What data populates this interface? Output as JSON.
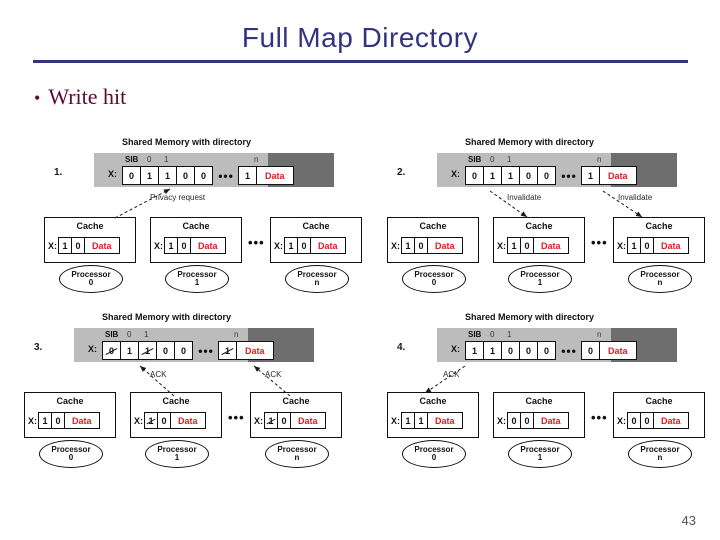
{
  "slide": {
    "title": "Full Map Directory",
    "bullet_marker": "•",
    "bullet_text": "Write hit",
    "page_number": "43",
    "colors": {
      "title": "#333380",
      "bullet": "#5b0a32",
      "data_text": "#e01b24",
      "memory_bar": "#bcbcbc",
      "memory_bar_dark": "#6e6e6e"
    }
  },
  "common": {
    "memory_title": "Shared Memory with directory",
    "sib_label": "SIB",
    "x_label": "X:",
    "cache_label": "Cache",
    "data_label": "Data",
    "ellipsis": "•••",
    "index_first": "0",
    "index_second": "1",
    "index_last": "n",
    "processor_word": "Processor"
  },
  "panels": [
    {
      "number": "1.",
      "memory_bits": [
        "0",
        "1",
        "1",
        "0",
        "0"
      ],
      "memory_bits_struck": [
        false,
        false,
        false,
        false,
        false
      ],
      "memory_last_bit": "1",
      "memory_last_struck": false,
      "memory_data": "Data",
      "arrow_labels": [
        "Privacy request"
      ],
      "caches": [
        {
          "bits": [
            "1",
            "0"
          ],
          "struck": [
            false,
            false
          ],
          "data": "Data"
        },
        {
          "bits": [
            "1",
            "0"
          ],
          "struck": [
            false,
            false
          ],
          "data": "Data"
        },
        {
          "bits": [
            "1",
            "0"
          ],
          "struck": [
            false,
            false
          ],
          "data": "Data"
        }
      ],
      "processors": [
        "0",
        "1",
        "n"
      ]
    },
    {
      "number": "2.",
      "memory_bits": [
        "0",
        "1",
        "1",
        "0",
        "0"
      ],
      "memory_bits_struck": [
        false,
        false,
        false,
        false,
        false
      ],
      "memory_last_bit": "1",
      "memory_last_struck": false,
      "memory_data": "Data",
      "arrow_labels": [
        "Invalidate",
        "Invalidate"
      ],
      "caches": [
        {
          "bits": [
            "1",
            "0"
          ],
          "struck": [
            false,
            false
          ],
          "data": "Data"
        },
        {
          "bits": [
            "1",
            "0"
          ],
          "struck": [
            false,
            false
          ],
          "data": "Data"
        },
        {
          "bits": [
            "1",
            "0"
          ],
          "struck": [
            false,
            false
          ],
          "data": "Data"
        }
      ],
      "processors": [
        "0",
        "1",
        "n"
      ]
    },
    {
      "number": "3.",
      "memory_bits": [
        "0",
        "1",
        "1",
        "0",
        "0"
      ],
      "memory_bits_struck": [
        true,
        false,
        true,
        false,
        false
      ],
      "memory_last_bit": "1",
      "memory_last_struck": true,
      "memory_data": "Data",
      "arrow_labels": [
        "ACK",
        "ACK"
      ],
      "caches": [
        {
          "bits": [
            "1",
            "0"
          ],
          "struck": [
            false,
            false
          ],
          "data": "Data"
        },
        {
          "bits": [
            "1",
            "0"
          ],
          "struck": [
            true,
            false
          ],
          "data": "Data"
        },
        {
          "bits": [
            "1",
            "0"
          ],
          "struck": [
            true,
            false
          ],
          "data": "Data"
        }
      ],
      "processors": [
        "0",
        "1",
        "n"
      ]
    },
    {
      "number": "4.",
      "memory_bits": [
        "1",
        "1",
        "0",
        "0",
        "0"
      ],
      "memory_bits_struck": [
        false,
        false,
        false,
        false,
        false
      ],
      "memory_last_bit": "0",
      "memory_last_struck": false,
      "memory_data": "Data",
      "arrow_labels": [
        "ACK"
      ],
      "caches": [
        {
          "bits": [
            "1",
            "1"
          ],
          "struck": [
            false,
            false
          ],
          "data": "Data"
        },
        {
          "bits": [
            "0",
            "0"
          ],
          "struck": [
            false,
            false
          ],
          "data": "Data"
        },
        {
          "bits": [
            "0",
            "0"
          ],
          "struck": [
            false,
            false
          ],
          "data": "Data"
        }
      ],
      "processors": [
        "0",
        "1",
        "n"
      ]
    }
  ]
}
